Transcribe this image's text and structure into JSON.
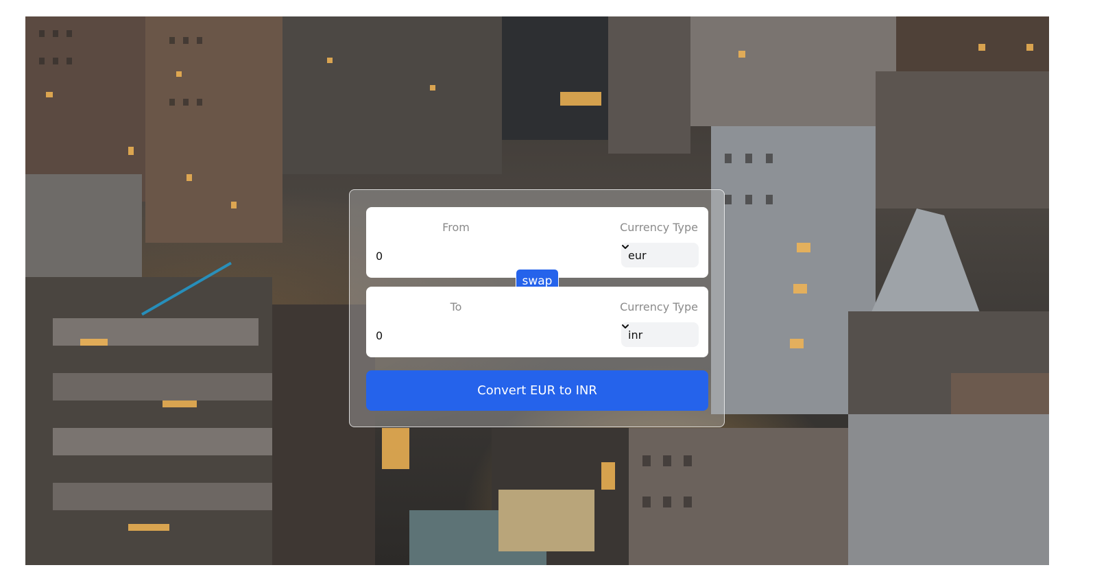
{
  "from_card": {
    "label": "From",
    "currency_type_label": "Currency Type",
    "amount": "0",
    "currency": "eur"
  },
  "to_card": {
    "label": "To",
    "currency_type_label": "Currency Type",
    "amount": "0",
    "currency": "inr"
  },
  "swap_button": {
    "label": "swap"
  },
  "convert_button": {
    "label": "Convert EUR to INR"
  },
  "colors": {
    "accent": "#2563eb",
    "card_bg": "#ffffff",
    "select_bg": "#f2f3f5",
    "muted_text": "#8a8a8a"
  },
  "icons": {
    "select_arrow": "chevron-down-icon"
  }
}
